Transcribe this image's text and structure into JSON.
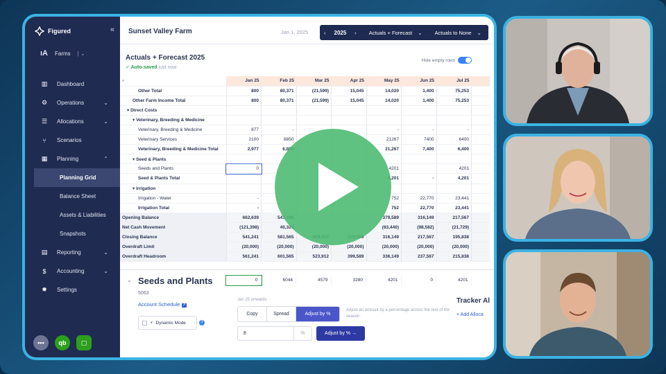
{
  "app": {
    "brand": "Figured",
    "farms_label": "Farms",
    "farm_name": "Sunset Valley Farm",
    "date": "Jan 1, 2025",
    "year": "2025",
    "view_mode": "Actuals + Forecast",
    "actuals_to": "Actuals to None"
  },
  "sidebar": {
    "items": [
      {
        "label": "Dashboard",
        "icon": "dashboard-icon"
      },
      {
        "label": "Operations",
        "icon": "tractor-icon"
      },
      {
        "label": "Allocations",
        "icon": "list-icon"
      },
      {
        "label": "Scenarios",
        "icon": "branch-icon"
      },
      {
        "label": "Planning",
        "icon": "grid-icon"
      },
      {
        "label": "Reporting",
        "icon": "report-icon"
      },
      {
        "label": "Accounting",
        "icon": "dollar-icon"
      },
      {
        "label": "Settings",
        "icon": "gear-icon"
      }
    ],
    "planning_sub": [
      "Planning Grid",
      "Balance Sheet",
      "Assets & Liabilities",
      "Snapshots"
    ]
  },
  "page": {
    "title": "Actuals + Forecast 2025",
    "autosaved": "Auto-saved",
    "autosaved_time": "just now",
    "hide_empty": "Hide empty rows"
  },
  "grid": {
    "months": [
      "Jan 25",
      "Feb 25",
      "Mar 25",
      "Apr 25",
      "May 25",
      "Jun 25",
      "Jul 25"
    ],
    "rows": [
      {
        "label": "Other Total",
        "cls": "bold",
        "indent": 3,
        "values": [
          "800",
          "80,371",
          "(21,599)",
          "15,045",
          "14,020",
          "1,400",
          "75,253"
        ]
      },
      {
        "label": "Other Farm Income Total",
        "cls": "bold",
        "indent": 2,
        "values": [
          "800",
          "80,371",
          "(21,599)",
          "15,045",
          "14,020",
          "1,400",
          "75,253"
        ]
      },
      {
        "label": "▾ Direct Costs",
        "cls": "section",
        "indent": 1,
        "values": [
          "",
          "",
          "",
          "",
          "",
          "",
          ""
        ]
      },
      {
        "label": "▾ Veterinary, Breeding & Medicine",
        "cls": "section",
        "indent": 2,
        "values": [
          "",
          "",
          "",
          "",
          "",
          "",
          ""
        ]
      },
      {
        "label": "Veterinary, Breeding & Medicine",
        "cls": "",
        "indent": 3,
        "values": [
          "877",
          "-",
          "",
          "",
          "-",
          "-",
          "-"
        ]
      },
      {
        "label": "Veterinary Services",
        "cls": "",
        "indent": 3,
        "values": [
          "2100",
          "6850",
          "",
          "",
          "21267",
          "7400",
          "6400"
        ]
      },
      {
        "label": "Veterinary, Breeding & Medicine Total",
        "cls": "bold",
        "indent": 3,
        "values": [
          "2,977",
          "6,850",
          "",
          "",
          "21,267",
          "7,400",
          "6,400"
        ]
      },
      {
        "label": "▾ Seed & Plants",
        "cls": "section",
        "indent": 2,
        "values": [
          "",
          "",
          "",
          "",
          "",
          "",
          ""
        ]
      },
      {
        "label": "Seeds and Plants",
        "cls": "",
        "indent": 3,
        "values": [
          "0",
          "",
          "",
          "",
          "4201",
          "",
          "4201"
        ]
      },
      {
        "label": "Seed & Plants Total",
        "cls": "bold",
        "indent": 3,
        "values": [
          "",
          "",
          "",
          "",
          "4,201",
          "-",
          "4,201"
        ]
      },
      {
        "label": "▾ Irrigation",
        "cls": "section",
        "indent": 2,
        "values": [
          "",
          "",
          "",
          "",
          "",
          "",
          ""
        ]
      },
      {
        "label": "Irrigation - Water",
        "cls": "",
        "indent": 3,
        "values": [
          "-",
          "",
          "",
          "",
          "752",
          "22,770",
          "23,441"
        ]
      },
      {
        "label": "Irrigation Total",
        "cls": "bold",
        "indent": 3,
        "values": [
          "-",
          "",
          "",
          "",
          "752",
          "22,770",
          "23,441"
        ]
      },
      {
        "label": "Opening Balance",
        "cls": "bal",
        "indent": 0,
        "values": [
          "662,639",
          "541,398",
          "",
          "",
          "379,589",
          "316,149",
          "217,567"
        ]
      },
      {
        "label": "Net Cash Movement",
        "cls": "bal",
        "indent": 0,
        "values": [
          "(121,398)",
          "40,324",
          "",
          "",
          "(63,440)",
          "(98,582)",
          "(21,729)"
        ]
      },
      {
        "label": "Closing Balance",
        "cls": "bal",
        "indent": 0,
        "values": [
          "541,241",
          "581,565",
          "503,912",
          "379,589",
          "316,149",
          "217,567",
          "195,838"
        ]
      },
      {
        "label": "Overdraft Limit",
        "cls": "bal",
        "indent": 0,
        "values": [
          "(20,000)",
          "(20,000)",
          "(20,000)",
          "(20,000)",
          "(20,000)",
          "(20,000)",
          "(20,000)"
        ]
      },
      {
        "label": "Overdraft Headroom",
        "cls": "bal",
        "indent": 0,
        "values": [
          "561,241",
          "601,565",
          "523,912",
          "399,589",
          "336,149",
          "237,567",
          "215,838"
        ]
      }
    ]
  },
  "panel": {
    "title": "Seeds and Plants",
    "code": "5063",
    "schedule_link": "Account Schedule",
    "dynamic_mode": "Dynamic Mode",
    "row_values": [
      "0",
      "6044",
      "4579",
      "3280",
      "4201",
      "0",
      "4201"
    ],
    "from": "Jan 25 onwards",
    "tabs": [
      "Copy",
      "Spread",
      "Adjust by %"
    ],
    "hint": "Adjust an amount by a percentage across the rest of the season.",
    "pct_value": "8",
    "pct_unit": "%",
    "apply_label": "Adjust by % →",
    "tracker": "Tracker Al",
    "add_alloc": "+ Add Alloca"
  },
  "colors": {
    "sidebar": "#202b52",
    "accent": "#3bb3e3",
    "play": "#4aba70",
    "header_row": "#fde8dd"
  }
}
